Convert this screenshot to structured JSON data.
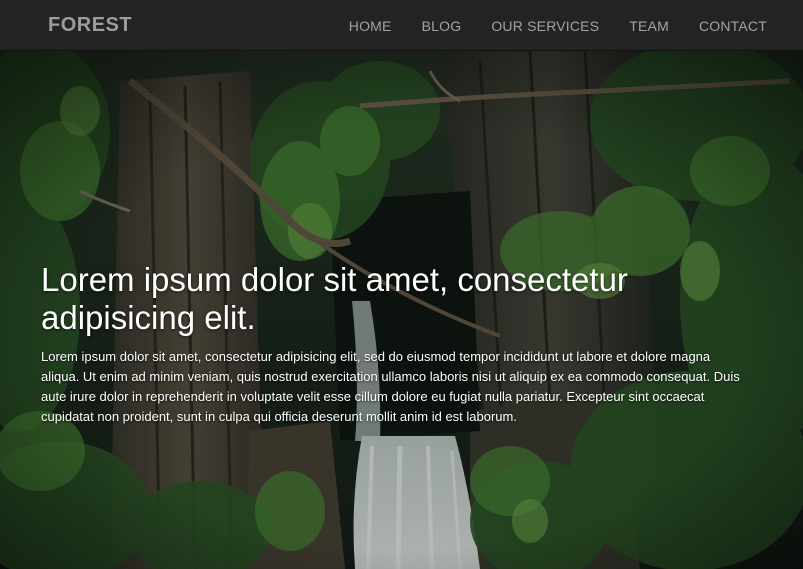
{
  "navbar": {
    "brand": "FOREST",
    "links": [
      "HOME",
      "BLOG",
      "OUR SERVICES",
      "TEAM",
      "CONTACT"
    ]
  },
  "hero": {
    "title": "Lorem ipsum dolor sit amet, consectetur adipisicing elit.",
    "text": "Lorem ipsum dolor sit amet, consectetur adipisicing elit, sed do eiusmod tempor incididunt ut labore et dolore magna aliqua. Ut enim ad minim veniam, quis nostrud exercitation ullamco laboris nisi ut aliquip ex ea commodo consequat. Duis aute irure dolor in reprehenderit in voluptate velit esse cillum dolore eu fugiat nulla pariatur. Excepteur sint occaecat cupidatat non proident, sunt in culpa qui officia deserunt mollit anim id est laborum."
  },
  "colors": {
    "navbar_bg": "#232323",
    "brand_text": "#9d9d9d",
    "nav_text": "#a3a3a3",
    "hero_text": "#ffffff"
  }
}
